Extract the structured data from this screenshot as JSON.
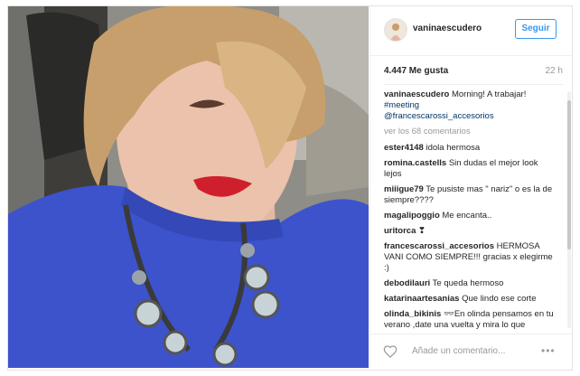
{
  "post": {
    "username": "vaninaescudero",
    "follow_label": "Seguir",
    "likes": "4.447 Me gusta",
    "time": "22 h",
    "caption": {
      "user": "vaninaescudero",
      "text": "Morning! A trabajar!",
      "hashtag": "#meeting",
      "mention": "@francescarossi_accesorios"
    },
    "view_all_label": "ver los 68 comentarios",
    "comments": [
      {
        "user": "ester4148",
        "text": "idola hermosa"
      },
      {
        "user": "romina.castells",
        "text": "Sin dudas el mejor look lejos"
      },
      {
        "user": "miiigue79",
        "text": "Te pusiste mas \" nariz\" o es la de siempre????"
      },
      {
        "user": "magalipoggio",
        "text": "Me encanta.."
      },
      {
        "user": "uritorca",
        "text": "❣"
      },
      {
        "user": "francescarossi_accesorios",
        "text": "HERMOSA VANI COMO SIEMPRE!!! gracias x elegirme :)"
      },
      {
        "user": "debodilauri",
        "text": "Te queda hermoso"
      },
      {
        "user": "katarinaartesanias",
        "text": "Que lindo ese corte"
      },
      {
        "user": "olinda_bikinis",
        "text": "👓En olinda pensamos en tu verano ,date una vuelta y mira lo que"
      }
    ],
    "add_comment_placeholder": "Añade un comentario...",
    "more_options": "•••"
  },
  "icons": {
    "like": "heart-outline-icon",
    "options": "more-options-icon",
    "avatar": "profile-avatar"
  },
  "colors": {
    "accent": "#3897f0",
    "link": "#003569",
    "muted": "#999999",
    "shirt": "#3c53cc",
    "lips": "#d01f2c"
  }
}
